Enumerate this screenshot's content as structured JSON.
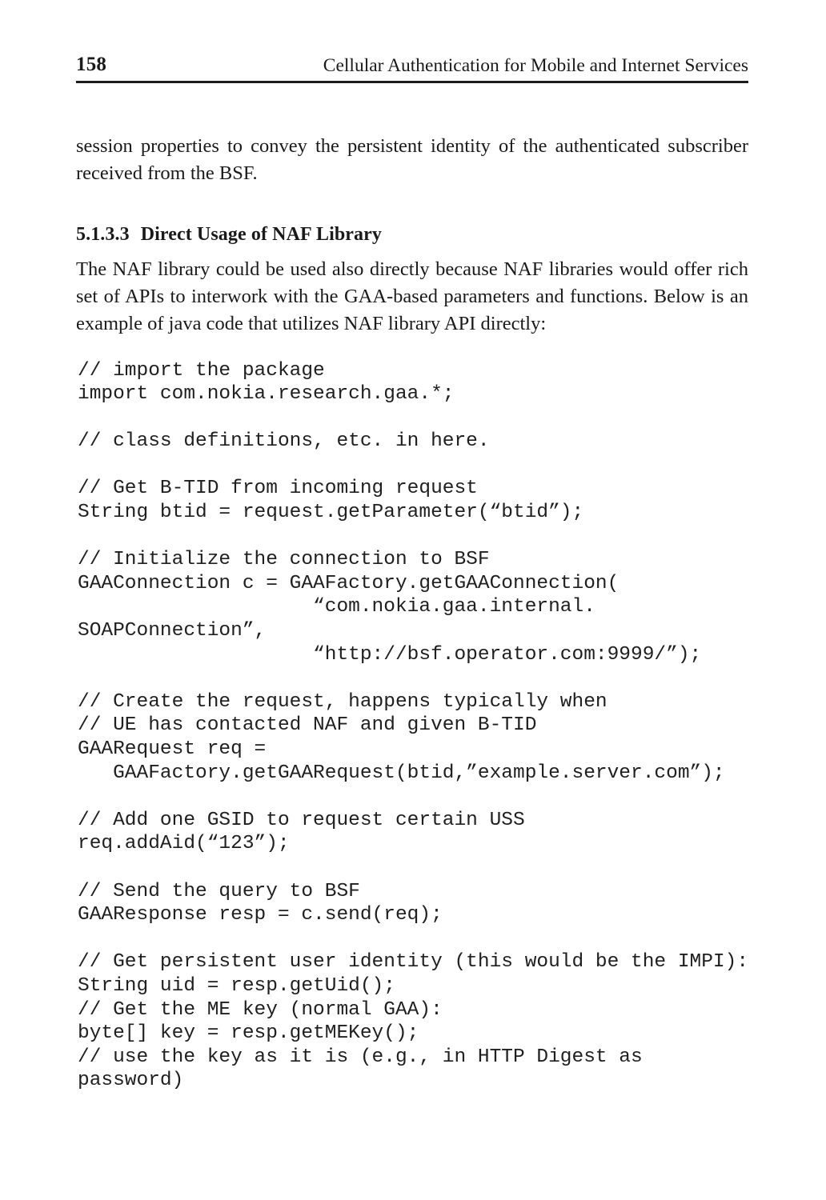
{
  "page": {
    "folio": "158",
    "running_title": "Cellular Authentication for Mobile and Internet Services"
  },
  "body": {
    "intro_paragraph": "session properties to convey the persistent identity of the authenticated subscriber received from the BSF.",
    "section": {
      "number": "5.1.3.3",
      "title": "Direct Usage of NAF Library"
    },
    "naf_paragraph": "The NAF library could be used also directly because NAF libraries would offer rich set of APIs to interwork with the GAA-based parameters and functions. Below is an example of java code that utilizes NAF library API directly:"
  },
  "code_block": {
    "language": "java",
    "lines": [
      "// import the package",
      "import com.nokia.research.gaa.*;",
      "",
      "// class definitions, etc. in here.",
      "",
      "// Get B-TID from incoming request",
      "String btid = request.getParameter(“btid”);",
      "",
      "// Initialize the connection to BSF",
      "GAAConnection c = GAAFactory.getGAAConnection(",
      "                    “com.nokia.gaa.internal.",
      "SOAPConnection”,",
      "                    “http://bsf.operator.com:9999/”);",
      "",
      "// Create the request, happens typically when",
      "// UE has contacted NAF and given B-TID",
      "GAARequest req =",
      "   GAAFactory.getGAARequest(btid,”example.server.com”);",
      "",
      "// Add one GSID to request certain USS",
      "req.addAid(“123”);",
      "",
      "// Send the query to BSF",
      "GAAResponse resp = c.send(req);",
      "",
      "// Get persistent user identity (this would be the IMPI):",
      "String uid = resp.getUid();",
      "// Get the ME key (normal GAA):",
      "byte[] key = resp.getMEKey();",
      "// use the key as it is (e.g., in HTTP Digest as",
      "password)"
    ]
  },
  "colors": {
    "text": "#1a1a1a",
    "code_text": "#1f1f1f",
    "rule": "#1c1c1c",
    "background": "#ffffff"
  }
}
